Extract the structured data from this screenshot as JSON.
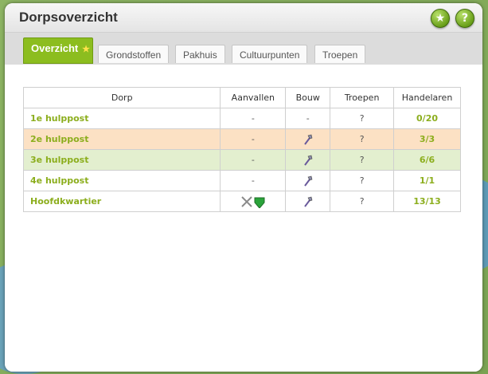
{
  "window": {
    "title": "Dorpsoverzicht",
    "favorite_button_icon": "star-icon",
    "help_button_label": "?"
  },
  "tabs": [
    {
      "label": "Overzicht",
      "active": true,
      "starred": true
    },
    {
      "label": "Grondstoffen",
      "active": false
    },
    {
      "label": "Pakhuis",
      "active": false
    },
    {
      "label": "Cultuurpunten",
      "active": false
    },
    {
      "label": "Troepen",
      "active": false
    }
  ],
  "table": {
    "headers": [
      "Dorp",
      "Aanvallen",
      "Bouw",
      "Troepen",
      "Handelaren"
    ],
    "rows": [
      {
        "dorp": "1e hulppost",
        "aanvallen": "-",
        "bouw": "-",
        "troepen": "?",
        "handelaren": "0/20",
        "highlight": "none"
      },
      {
        "dorp": "2e hulppost",
        "aanvallen": "-",
        "bouw": "hammer-icon",
        "troepen": "?",
        "handelaren": "3/3",
        "highlight": "orange"
      },
      {
        "dorp": "3e hulppost",
        "aanvallen": "-",
        "bouw": "hammer-icon",
        "troepen": "?",
        "handelaren": "6/6",
        "highlight": "green"
      },
      {
        "dorp": "4e hulppost",
        "aanvallen": "-",
        "bouw": "hammer-icon",
        "troepen": "?",
        "handelaren": "1/1",
        "highlight": "none"
      },
      {
        "dorp": "Hoofdkwartier",
        "aanvallen": "swords-shield-icon",
        "bouw": "hammer-icon",
        "troepen": "?",
        "handelaren": "13/13",
        "highlight": "none"
      }
    ]
  },
  "colors": {
    "accent_green": "#8cbd1f",
    "link_green": "#8cae1d",
    "row_orange": "#fce1c4",
    "row_green": "#e3efcf"
  }
}
